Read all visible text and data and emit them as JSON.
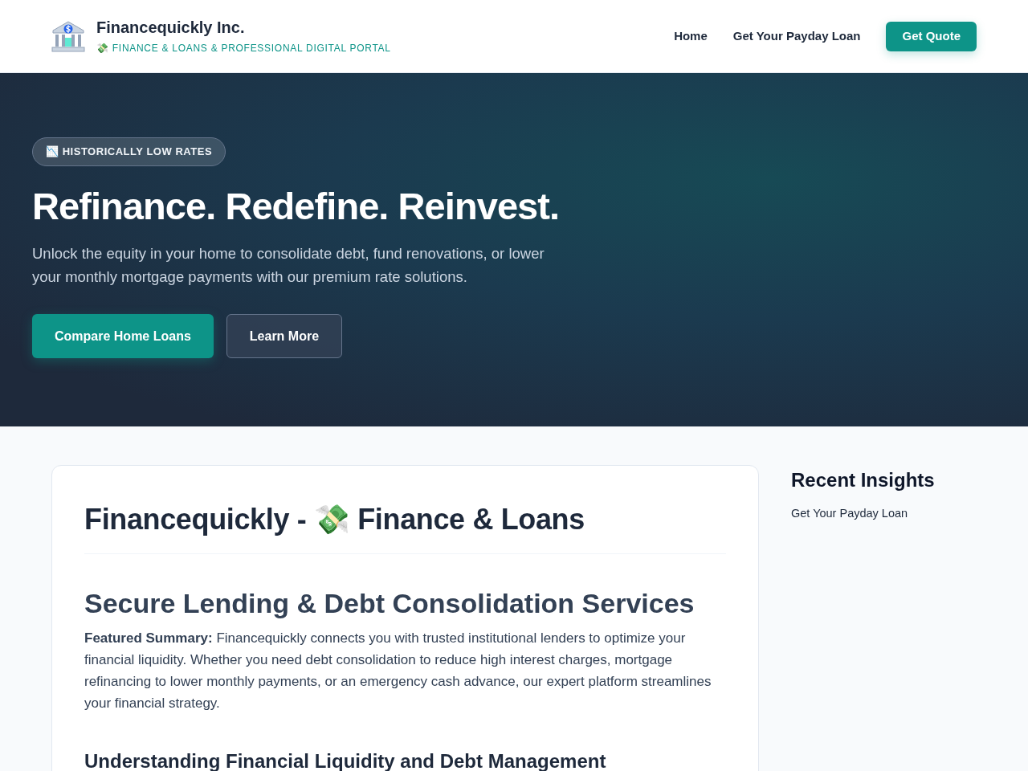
{
  "header": {
    "logo_title": "Financequickly Inc.",
    "logo_subtitle": "💸 FINANCE & LOANS & PROFESSIONAL DIGITAL PORTAL",
    "nav": [
      {
        "label": "Home"
      },
      {
        "label": "Get Your Payday Loan"
      }
    ],
    "cta": "Get Quote"
  },
  "hero": {
    "badge": "📉 HISTORICALLY LOW RATES",
    "title": "Refinance. Redefine. Reinvest.",
    "text": "Unlock the equity in your home to consolidate debt, fund renovations, or lower your monthly mortgage payments with our premium rate solutions.",
    "buttons": [
      {
        "label": "Compare Home Loans",
        "kind": "primary"
      },
      {
        "label": "Learn More",
        "kind": "secondary"
      }
    ]
  },
  "article": {
    "title": "Financequickly - 💸 Finance & Loans",
    "heading": "Secure Lending & Debt Consolidation Services",
    "summary": "**Featured Summary:** Financequickly connects you with trusted institutional lenders to optimize your financial liquidity. Whether you need debt consolidation to reduce high interest charges, mortgage refinancing to lower monthly payments, or an emergency cash advance, our expert platform streamlines your financial strategy.",
    "subheading": "Understanding Financial Liquidity and Debt Management"
  },
  "sidebar": {
    "title": "Recent Insights",
    "links": [
      "Get Your Payday Loan"
    ]
  }
}
